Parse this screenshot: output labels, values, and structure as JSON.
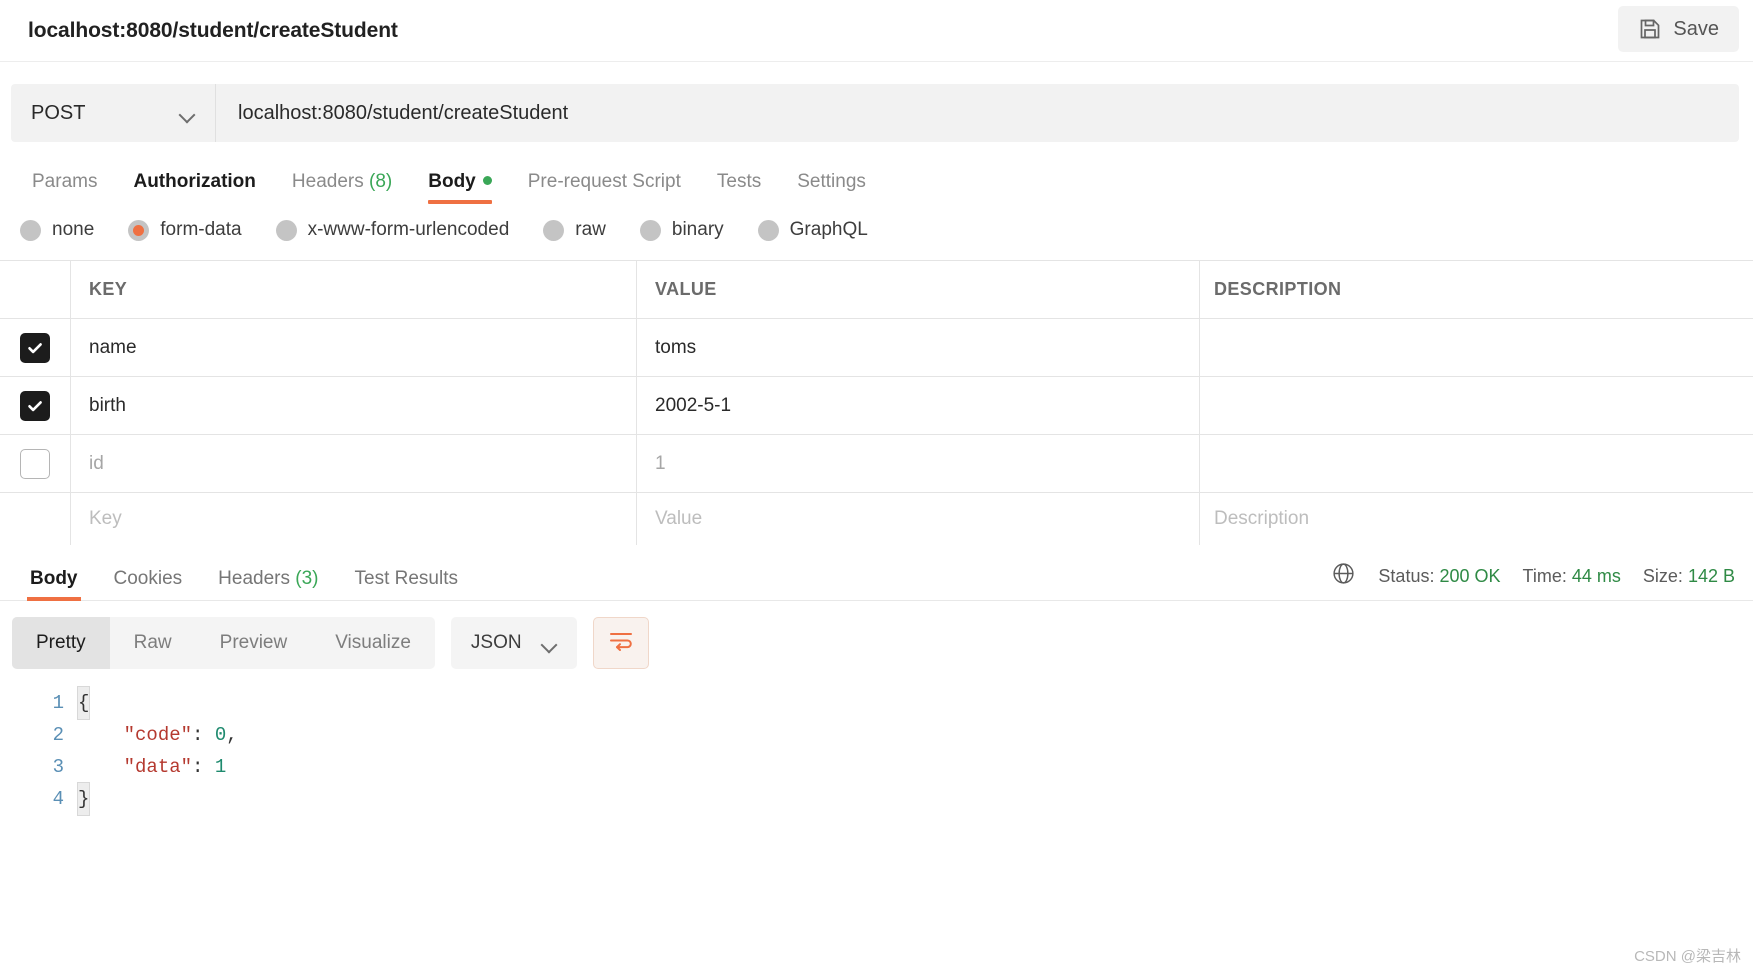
{
  "header": {
    "request_title": "localhost:8080/student/createStudent",
    "save_label": "Save",
    "save_icon": "floppy-disk-icon"
  },
  "urlbar": {
    "method": "POST",
    "method_chevron_icon": "chevron-down-icon",
    "url": "localhost:8080/student/createStudent"
  },
  "request_tabs": [
    {
      "label": "Params",
      "state": "inactive"
    },
    {
      "label": "Authorization",
      "state": "strong"
    },
    {
      "label": "Headers",
      "count": "(8)",
      "state": "inactive"
    },
    {
      "label": "Body",
      "state": "active",
      "dot": true
    },
    {
      "label": "Pre-request Script",
      "state": "inactive"
    },
    {
      "label": "Tests",
      "state": "inactive"
    },
    {
      "label": "Settings",
      "state": "inactive"
    }
  ],
  "body_types": [
    {
      "label": "none",
      "selected": false
    },
    {
      "label": "form-data",
      "selected": true
    },
    {
      "label": "x-www-form-urlencoded",
      "selected": false
    },
    {
      "label": "raw",
      "selected": false
    },
    {
      "label": "binary",
      "selected": false
    },
    {
      "label": "GraphQL",
      "selected": false
    }
  ],
  "params_table": {
    "columns": [
      "KEY",
      "VALUE",
      "DESCRIPTION"
    ],
    "rows": [
      {
        "checked": true,
        "key": "name",
        "value": "toms",
        "description": "",
        "muted": false
      },
      {
        "checked": true,
        "key": "birth",
        "value": "2002-5-1",
        "description": "",
        "muted": false
      },
      {
        "checked": false,
        "key": "id",
        "value": "1",
        "description": "",
        "muted": true
      }
    ],
    "placeholder_row": {
      "key": "Key",
      "value": "Value",
      "description": "Description"
    }
  },
  "response": {
    "tabs": [
      {
        "label": "Body",
        "state": "active"
      },
      {
        "label": "Cookies",
        "state": "inactive"
      },
      {
        "label": "Headers",
        "count": "(3)",
        "state": "inactive"
      },
      {
        "label": "Test Results",
        "state": "inactive"
      }
    ],
    "globe_icon": "globe-icon",
    "status_label": "Status:",
    "status_value": "200 OK",
    "time_label": "Time:",
    "time_value": "44 ms",
    "size_label": "Size:",
    "size_value": "142 B",
    "status_color": "#2f8a45"
  },
  "viewer": {
    "modes": [
      {
        "label": "Pretty",
        "selected": true
      },
      {
        "label": "Raw",
        "selected": false
      },
      {
        "label": "Preview",
        "selected": false
      },
      {
        "label": "Visualize",
        "selected": false
      }
    ],
    "format": "JSON",
    "format_chevron_icon": "chevron-down-icon",
    "wrap_icon": "word-wrap-icon"
  },
  "code": {
    "lines": [
      {
        "n": "1",
        "brace": "{"
      },
      {
        "n": "2",
        "indent": "    ",
        "key": "\"code\"",
        "sep": ": ",
        "val": "0",
        "tail": ","
      },
      {
        "n": "3",
        "indent": "    ",
        "key": "\"data\"",
        "sep": ": ",
        "val": "1",
        "tail": ""
      },
      {
        "n": "4",
        "brace": "}"
      }
    ]
  },
  "watermark": "CSDN @梁吉林",
  "colors": {
    "accent": "#ef7042",
    "green": "#3aa757"
  }
}
